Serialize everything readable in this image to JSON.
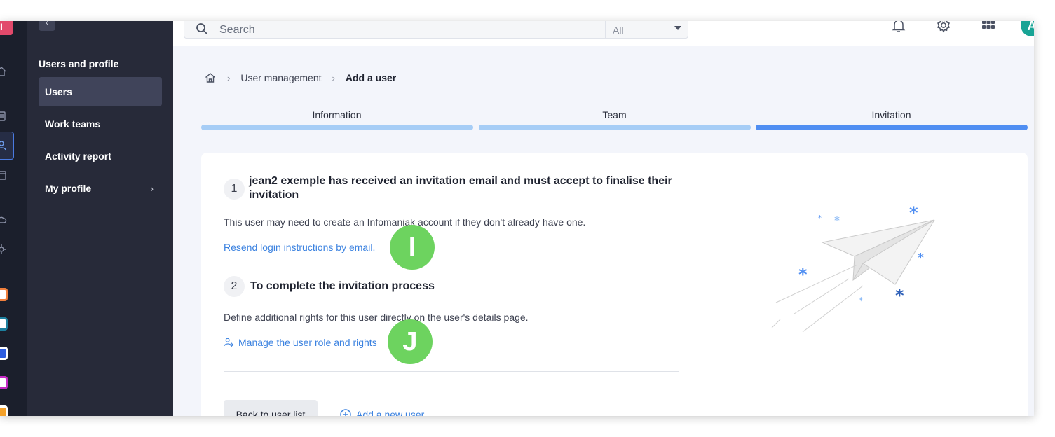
{
  "app": {
    "logo_letter": "I",
    "accent": "#4f8ef2",
    "rail_bg": "#1b1f2c",
    "sidebar_bg": "#272a39"
  },
  "rail": {
    "icons": [
      "home-icon",
      "document-icon",
      "users-icon",
      "calendar-icon",
      "cloud-icon",
      "settings-icon"
    ],
    "apps": [
      "app-icon-orange",
      "app-icon-teal",
      "app-icon-blue",
      "app-icon-purple",
      "app-icon-yellow"
    ]
  },
  "sidebar": {
    "collapse_glyph": "‹",
    "heading": "Users and profile",
    "items": [
      {
        "label": "Users",
        "selected": true
      },
      {
        "label": "Work teams",
        "selected": false
      },
      {
        "label": "Activity report",
        "selected": false
      },
      {
        "label": "My profile",
        "selected": false,
        "has_chevron": true
      }
    ],
    "chevron": "›"
  },
  "header": {
    "search_placeholder": "Search",
    "scope_value": "All",
    "avatar_letter": "A",
    "icons": [
      "bell-icon",
      "settings-icon",
      "apps-grid-icon"
    ]
  },
  "breadcrumb": {
    "items": [
      "User management",
      "Add a user"
    ],
    "separator": "›"
  },
  "stepper": {
    "steps": [
      "Information",
      "Team",
      "Invitation"
    ],
    "active_index": 2
  },
  "card": {
    "step1": {
      "number": "1",
      "title_line1": "jean2 exemple has received an invitation email and must accept to finalise their",
      "title_line2": "invitation",
      "description": "This user may need to create an Infomaniak account if they don't already have one.",
      "link": "Resend login instructions by email."
    },
    "step2": {
      "number": "2",
      "title": "To complete the invitation process",
      "description": "Define additional rights for this user directly on the user's details page.",
      "link": "Manage the user role and rights"
    },
    "back_button": "Back to user list",
    "add_link": "Add a new user"
  },
  "annotations": {
    "badge_i": "I",
    "badge_j": "J",
    "color": "#6dd35f"
  }
}
